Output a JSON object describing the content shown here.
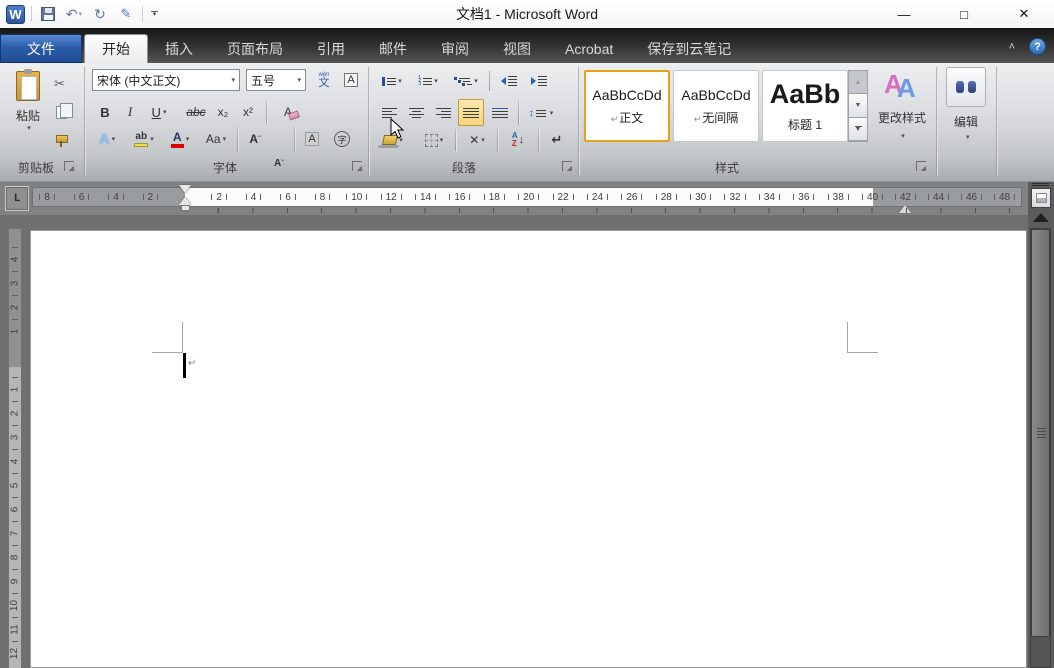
{
  "window": {
    "title": "文档1 - Microsoft Word",
    "minimize_glyph": "—",
    "maximize_glyph": "□",
    "close_glyph": "✕"
  },
  "qat": {
    "logo_letter": "W",
    "undo_glyph": "↶",
    "redo_glyph": "↻",
    "pen_glyph": "✎",
    "dropdown_glyph": "▾"
  },
  "tab_bar": {
    "file": "文件",
    "active": "开始",
    "tabs": [
      "插入",
      "页面布局",
      "引用",
      "邮件",
      "审阅",
      "视图",
      "Acrobat",
      "保存到云笔记"
    ],
    "collapse_glyph": "˄",
    "help_glyph": "?"
  },
  "ribbon": {
    "clipboard": {
      "label": "剪贴板",
      "paste_label": "粘贴",
      "scissors_glyph": "✂"
    },
    "font": {
      "label": "字体",
      "name_value": "宋体 (中文正文)",
      "size_value": "五号",
      "bold": "B",
      "italic": "I",
      "underline": "U",
      "strikethrough": "abc",
      "subscript": "x₂",
      "superscript": "x²",
      "pinyin_small": "wén",
      "pinyin_char": "文",
      "char_border_letter": "A",
      "clear_letter": "A",
      "effects_letter": "A",
      "highlight_letters": "ab",
      "color_letter": "A",
      "case_letters": "Aa",
      "grow_letter": "A",
      "grow_mark": "ˆ",
      "shrink_letter": "A",
      "shrink_mark": "ˇ",
      "shading_letter": "A",
      "circle_char": "字"
    },
    "paragraph": {
      "label": "段落",
      "updown_glyph": "↕",
      "asian_glyph": "✕",
      "sort_top": "A",
      "sort_bottom": "Z",
      "sort_arrow": "↓",
      "marks_glyph": "↵"
    },
    "styles": {
      "label": "样式",
      "up_glyph": "▲",
      "down_glyph": "▼",
      "gallery": [
        {
          "preview": "AaBbCcDd",
          "name": "正文"
        },
        {
          "preview": "AaBbCcDd",
          "name": "无间隔"
        },
        {
          "preview": "AaBb",
          "name": "标题 1"
        }
      ],
      "pilcrow": "↵"
    },
    "change_styles": {
      "label": "更改样式",
      "letter_a1": "A",
      "letter_a2": "A"
    },
    "editing": {
      "label": "编辑"
    },
    "dropdown_glyph": "▾"
  },
  "ruler": {
    "tab_selector": "L",
    "h_margin_left": [
      "8",
      "6",
      "4",
      "2"
    ],
    "h_text": [
      "2",
      "4",
      "6",
      "8",
      "10",
      "12",
      "14",
      "16",
      "18",
      "20",
      "22",
      "24",
      "26",
      "28",
      "30",
      "32",
      "34",
      "36",
      "38"
    ],
    "h_margin_right": [
      "40",
      "42",
      "44",
      "46",
      "48"
    ],
    "v_margin_top": [
      "4",
      "3",
      "2",
      "1"
    ],
    "v_body": [
      "1",
      "2",
      "3",
      "4",
      "5",
      "6",
      "7",
      "8",
      "9",
      "10",
      "11",
      "12"
    ]
  },
  "document": {
    "pilcrow": "↵"
  }
}
